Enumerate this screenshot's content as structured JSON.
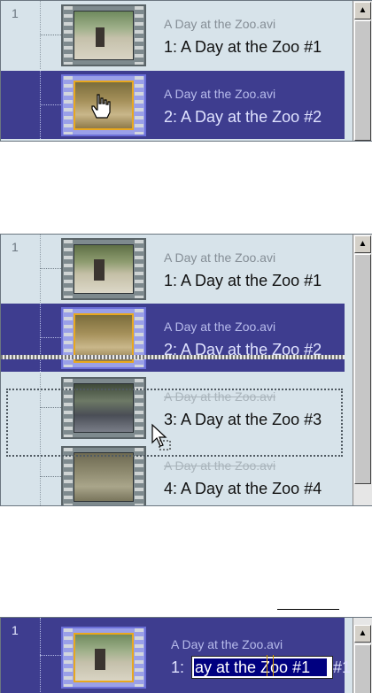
{
  "colors": {
    "selection": "#3e3d8f",
    "panel": "#d7e3ea",
    "accent_frame": "#e8a81e",
    "edit_highlight": "#000080"
  },
  "icons": [
    "film-strip-icon",
    "hand-cursor-icon",
    "drag-arrow-cursor-icon",
    "scroll-up-arrow-icon"
  ],
  "panel1": {
    "scene_number": "1",
    "clips": [
      {
        "file": "A Day at the Zoo.avi",
        "title": "1:   A Day at the Zoo #1",
        "selected": false
      },
      {
        "file": "A Day at the Zoo.avi",
        "title": "2:   A Day at the Zoo #2",
        "selected": true
      }
    ]
  },
  "panel2": {
    "scene_number": "1",
    "clips": [
      {
        "file": "A Day at the Zoo.avi",
        "title": "1:   A Day at the Zoo #1",
        "selected": false
      },
      {
        "file": "A Day at the Zoo.avi",
        "title": "2:   A Day at the Zoo #2",
        "selected": true
      },
      {
        "file": "A Day at the Zoo.avi",
        "title": "3:   A Day at the Zoo #3",
        "selected": false
      },
      {
        "file": "A Day at the Zoo.avi",
        "title": "4:   A Day at the Zoo #4",
        "selected": false
      }
    ],
    "scroll_up": "▲"
  },
  "panel3": {
    "scene_number": "1",
    "clip": {
      "file": "A Day at the Zoo.avi",
      "number": "1:",
      "edit_value": "ay at the Zoo #1",
      "suffix": "#1"
    },
    "scroll_up": "▲"
  }
}
